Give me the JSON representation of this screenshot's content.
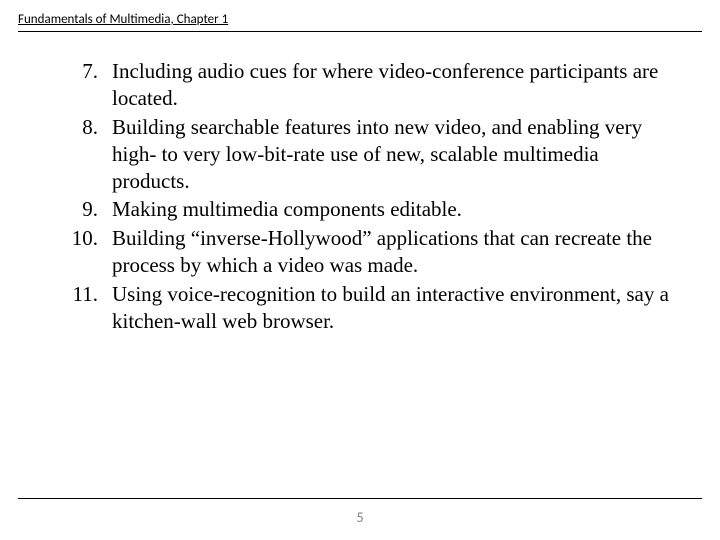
{
  "header": {
    "title": "Fundamentals of Multimedia, Chapter 1"
  },
  "list": {
    "items": [
      {
        "n": "7.",
        "text": "Including audio cues for where video-conference participants are located."
      },
      {
        "n": "8.",
        "text": "Building searchable features into new video, and enabling very high- to very low-bit-rate use of new, scalable multimedia products."
      },
      {
        "n": "9.",
        "text": "Making multimedia components editable."
      },
      {
        "n": "10.",
        "text": "Building “inverse-Hollywood” applications that can recreate the process by which a video was made."
      },
      {
        "n": "11.",
        "text": "Using voice-recognition to build an interactive environment, say a kitchen-wall web browser."
      }
    ]
  },
  "footer": {
    "page_number": "5"
  }
}
